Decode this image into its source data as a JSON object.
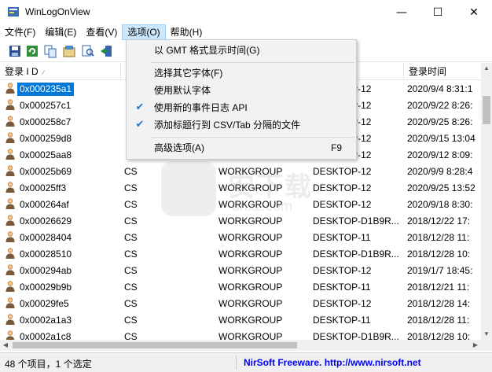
{
  "window": {
    "title": "WinLogOnView"
  },
  "menubar": [
    "文件(F)",
    "编辑(E)",
    "查看(V)",
    "选项(O)",
    "帮助(H)"
  ],
  "toolbar": {
    "buttons": [
      "save-icon",
      "refresh-icon",
      "copy-icon",
      "properties-icon",
      "find-icon",
      "exit-icon"
    ]
  },
  "list": {
    "columns": [
      "登录 I D",
      "",
      "",
      "",
      "登录时间"
    ],
    "rows": [
      [
        "0x000235a1",
        "",
        "",
        "DESKTOP-12",
        "2020/9/4 8:31:1"
      ],
      [
        "0x000257c1",
        "",
        "",
        "DESKTOP-12",
        "2020/9/22 8:26:"
      ],
      [
        "0x000258c7",
        "",
        "",
        "DESKTOP-12",
        "2020/9/25 8:26:"
      ],
      [
        "0x000259d8",
        "",
        "",
        "DESKTOP-12",
        "2020/9/15 13:04"
      ],
      [
        "0x00025aa8",
        "",
        "",
        "DESKTOP-12",
        "2020/9/12 8:09:"
      ],
      [
        "0x00025b69",
        "CS",
        "WORKGROUP",
        "DESKTOP-12",
        "2020/9/9 8:28:4"
      ],
      [
        "0x00025ff3",
        "CS",
        "WORKGROUP",
        "DESKTOP-12",
        "2020/9/25 13:52"
      ],
      [
        "0x000264af",
        "CS",
        "WORKGROUP",
        "DESKTOP-12",
        "2020/9/18 8:30:"
      ],
      [
        "0x00026629",
        "CS",
        "WORKGROUP",
        "DESKTOP-D1B9R...",
        "2018/12/22 17:"
      ],
      [
        "0x00028404",
        "CS",
        "WORKGROUP",
        "DESKTOP-11",
        "2018/12/28 11:"
      ],
      [
        "0x00028510",
        "CS",
        "WORKGROUP",
        "DESKTOP-D1B9R...",
        "2018/12/28 10:"
      ],
      [
        "0x000294ab",
        "CS",
        "WORKGROUP",
        "DESKTOP-12",
        "2019/1/7 18:45:"
      ],
      [
        "0x00029b9b",
        "CS",
        "WORKGROUP",
        "DESKTOP-11",
        "2018/12/21 11:"
      ],
      [
        "0x00029fe5",
        "CS",
        "WORKGROUP",
        "DESKTOP-12",
        "2018/12/28 14:"
      ],
      [
        "0x0002a1a3",
        "CS",
        "WORKGROUP",
        "DESKTOP-11",
        "2018/12/28 11:"
      ],
      [
        "0x0002a1c8",
        "CS",
        "WORKGROUP",
        "DESKTOP-D1B9R...",
        "2018/12/28 10:"
      ]
    ],
    "selected_index": 0
  },
  "options_menu": {
    "items": [
      {
        "label": "以 GMT 格式显示时间(G)",
        "checked": false,
        "accel": ""
      },
      {
        "label": "选择其它字体(F)",
        "checked": false,
        "accel": ""
      },
      {
        "label": "使用默认字体",
        "checked": false,
        "accel": ""
      },
      {
        "label": "使用新的事件日志 API",
        "checked": true,
        "accel": ""
      },
      {
        "label": "添加标题行到 CSV/Tab 分隔的文件",
        "checked": true,
        "accel": ""
      },
      {
        "label": "高级选项(A)",
        "checked": false,
        "accel": "F9"
      }
    ],
    "check_glyph": "✔"
  },
  "statusbar": {
    "left": "48 个项目，1 个选定",
    "right": "NirSoft Freeware.  http://www.nirsoft.net"
  },
  "window_controls": {
    "minimize": "—",
    "maximize": "☐",
    "close": "✕"
  },
  "scroll": {
    "up": "▲",
    "down": "▼",
    "left": "◀",
    "right": "▶"
  },
  "watermark": {
    "text": "安下载",
    "url": "anxz.com"
  },
  "colors": {
    "selection": "#0078d7",
    "menu_highlight": "#cce8ff",
    "link": "#0000ff",
    "check": "#1e76d6"
  }
}
